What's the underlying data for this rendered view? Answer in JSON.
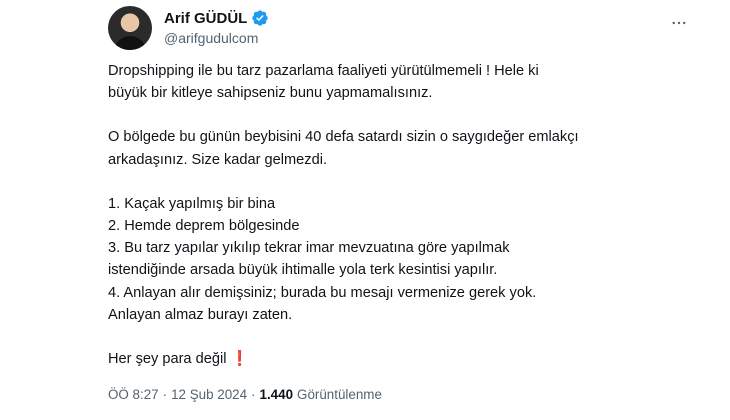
{
  "author": {
    "display_name": "Arif GÜDÜL",
    "handle": "@arifgudulcom",
    "verified": true
  },
  "tweet": {
    "paragraphs": [
      {
        "lines": [
          "Dropshipping ile bu tarz pazarlama faaliyeti yürütülmemeli ! Hele ki",
          "büyük bir kitleye sahipseniz bunu yapmamalısınız."
        ]
      },
      {
        "lines": [
          "O bölgede bu günün beybisini 40 defa satardı sizin o saygıdeğer emlakçı",
          "arkadaşınız.  Size kadar gelmezdi."
        ]
      },
      {
        "lines": [
          "1. Kaçak yapılmış bir bina",
          "2. Hemde deprem bölgesinde",
          "3. Bu tarz yapılar yıkılıp tekrar imar mevzuatına göre yapılmak",
          "istendiğinde arsada büyük ihtimalle yola terk kesintisi yapılır.",
          "4. Anlayan alır demişsiniz; burada bu mesajı vermenize gerek yok.",
          "Anlayan almaz burayı zaten."
        ]
      }
    ],
    "closing_text": "Her şey para değil ",
    "closing_emoji": "❗"
  },
  "meta": {
    "time": "ÖÖ 8:27",
    "separator": "·",
    "date": "12 Şub 2024",
    "views_count": "1.440",
    "views_label": "Görüntülenme"
  },
  "colors": {
    "text": "#0f1419",
    "secondary": "#536471",
    "verified_blue": "#1d9bf0"
  },
  "icons": {
    "verified": "verified-badge-icon",
    "more": "more-options-icon"
  }
}
